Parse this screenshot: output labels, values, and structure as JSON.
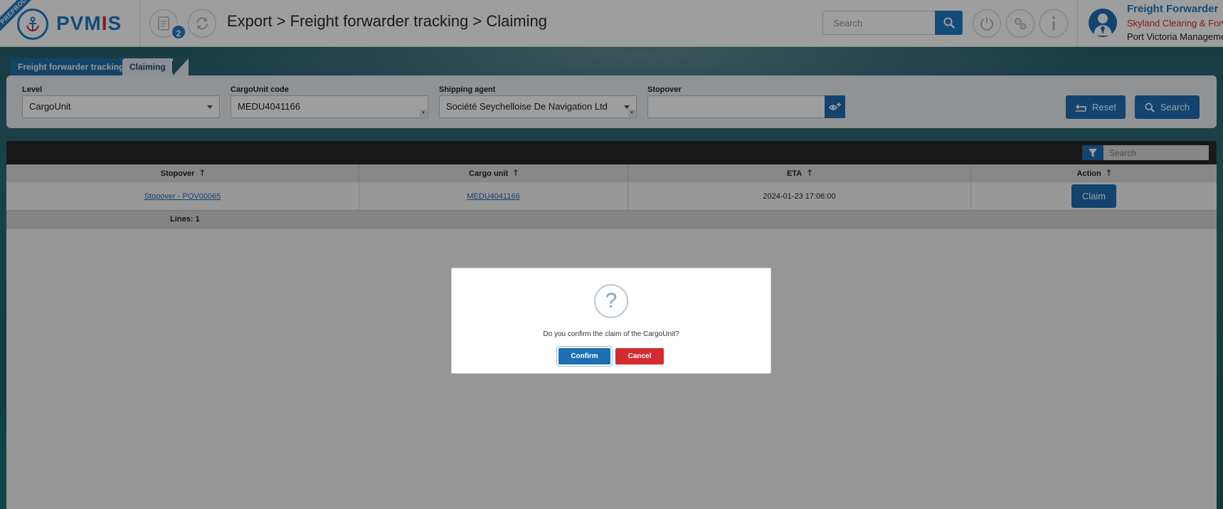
{
  "env_ribbon": "PREPROD",
  "app": {
    "logo_left": "PVM",
    "logo_mid": "I",
    "logo_right": "S"
  },
  "header": {
    "notification_count": "2",
    "breadcrumb": "Export > Freight forwarder tracking > Claiming",
    "search_placeholder": "Search"
  },
  "user": {
    "role": "Freight Forwarder",
    "company": "Skyland Clearing & Forwarding",
    "organization": "Port Victoria Management"
  },
  "tabs": [
    {
      "label": "Freight forwarder tracking"
    },
    {
      "label": "Claiming"
    }
  ],
  "filters": {
    "level": {
      "label": "Level",
      "value": "CargoUnit"
    },
    "cargounit_code": {
      "label": "CargoUnit code",
      "value": "MEDU4041166"
    },
    "shipping_agent": {
      "label": "Shipping agent",
      "value": "Société Seychelloise De Navigation Ltd"
    },
    "stopover": {
      "label": "Stopover",
      "value": ""
    },
    "reset_label": "Reset",
    "search_label": "Search"
  },
  "table": {
    "search_placeholder": "Search",
    "columns": [
      "Stopover",
      "Cargo unit",
      "ETA",
      "Action"
    ],
    "rows": [
      {
        "stopover": "Stopover - POV00065",
        "cargo_unit": "MEDU4041166",
        "eta": "2024-01-23 17:06:00",
        "action": "Claim"
      }
    ],
    "lines_label": "Lines: 1"
  },
  "dialog": {
    "icon": "?",
    "message": "Do you confirm the claim of the CargoUnit?",
    "confirm_label": "Confirm",
    "cancel_label": "Cancel"
  },
  "colors": {
    "primary": "#1d7bc7",
    "danger": "#d42b2f",
    "brand_red": "#d9262e"
  }
}
